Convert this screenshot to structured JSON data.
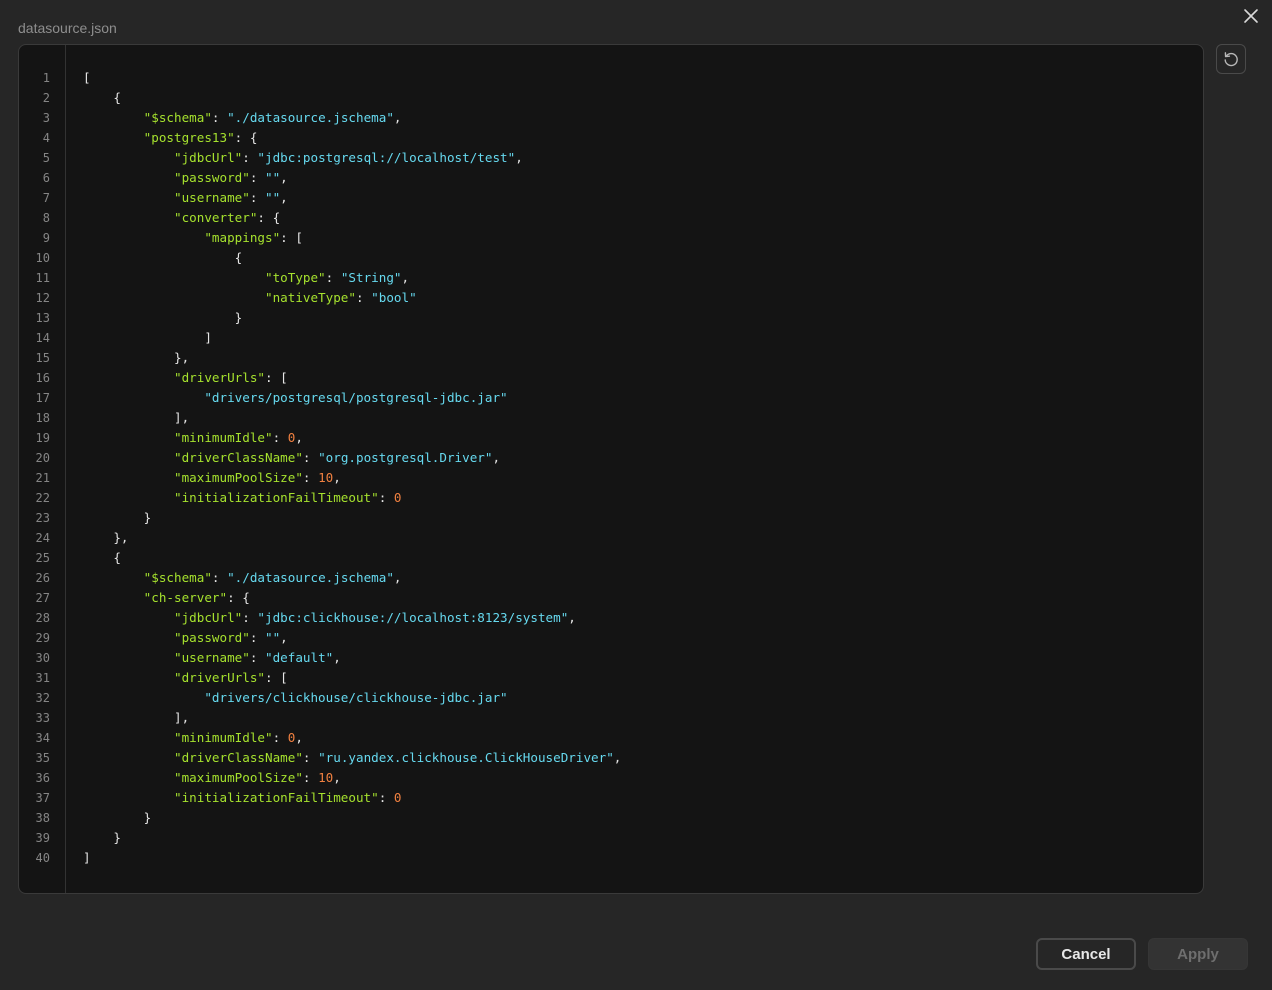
{
  "dialog": {
    "title": "datasource.json",
    "cancel_label": "Cancel",
    "apply_label": "Apply",
    "apply_disabled": true
  },
  "icons": {
    "close": "close-icon",
    "reset": "reset-icon"
  },
  "colors": {
    "background": "#262626",
    "editor_background": "#141414",
    "key": "#a6e22e",
    "string": "#66d9ef",
    "number": "#f08040",
    "punctuation": "#e6e6e6",
    "line_number": "#858585"
  },
  "editor": {
    "line_numbers": [
      "1",
      "2",
      "3",
      "4",
      "5",
      "6",
      "7",
      "8",
      "9",
      "10",
      "11",
      "12",
      "13",
      "14",
      "15",
      "16",
      "17",
      "18",
      "19",
      "20",
      "21",
      "22",
      "23",
      "24",
      "25",
      "26",
      "27",
      "28",
      "29",
      "30",
      "31",
      "32",
      "33",
      "34",
      "35",
      "36",
      "37",
      "38",
      "39",
      "40"
    ],
    "lines": [
      [
        {
          "t": "p",
          "v": "["
        }
      ],
      [
        {
          "t": "p",
          "v": "    {"
        }
      ],
      [
        {
          "t": "p",
          "v": "        "
        },
        {
          "t": "k",
          "v": "\"$schema\""
        },
        {
          "t": "p",
          "v": ": "
        },
        {
          "t": "s",
          "v": "\"./datasource.jschema\""
        },
        {
          "t": "p",
          "v": ","
        }
      ],
      [
        {
          "t": "p",
          "v": "        "
        },
        {
          "t": "k",
          "v": "\"postgres13\""
        },
        {
          "t": "p",
          "v": ": {"
        }
      ],
      [
        {
          "t": "p",
          "v": "            "
        },
        {
          "t": "k",
          "v": "\"jdbcUrl\""
        },
        {
          "t": "p",
          "v": ": "
        },
        {
          "t": "s",
          "v": "\"jdbc:postgresql://localhost/test\""
        },
        {
          "t": "p",
          "v": ","
        }
      ],
      [
        {
          "t": "p",
          "v": "            "
        },
        {
          "t": "k",
          "v": "\"password\""
        },
        {
          "t": "p",
          "v": ": "
        },
        {
          "t": "s",
          "v": "\"\""
        },
        {
          "t": "p",
          "v": ","
        }
      ],
      [
        {
          "t": "p",
          "v": "            "
        },
        {
          "t": "k",
          "v": "\"username\""
        },
        {
          "t": "p",
          "v": ": "
        },
        {
          "t": "s",
          "v": "\"\""
        },
        {
          "t": "p",
          "v": ","
        }
      ],
      [
        {
          "t": "p",
          "v": "            "
        },
        {
          "t": "k",
          "v": "\"converter\""
        },
        {
          "t": "p",
          "v": ": {"
        }
      ],
      [
        {
          "t": "p",
          "v": "                "
        },
        {
          "t": "k",
          "v": "\"mappings\""
        },
        {
          "t": "p",
          "v": ": ["
        }
      ],
      [
        {
          "t": "p",
          "v": "                    {"
        }
      ],
      [
        {
          "t": "p",
          "v": "                        "
        },
        {
          "t": "k",
          "v": "\"toType\""
        },
        {
          "t": "p",
          "v": ": "
        },
        {
          "t": "s",
          "v": "\"String\""
        },
        {
          "t": "p",
          "v": ","
        }
      ],
      [
        {
          "t": "p",
          "v": "                        "
        },
        {
          "t": "k",
          "v": "\"nativeType\""
        },
        {
          "t": "p",
          "v": ": "
        },
        {
          "t": "s",
          "v": "\"bool\""
        }
      ],
      [
        {
          "t": "p",
          "v": "                    }"
        }
      ],
      [
        {
          "t": "p",
          "v": "                ]"
        }
      ],
      [
        {
          "t": "p",
          "v": "            },"
        }
      ],
      [
        {
          "t": "p",
          "v": "            "
        },
        {
          "t": "k",
          "v": "\"driverUrls\""
        },
        {
          "t": "p",
          "v": ": ["
        }
      ],
      [
        {
          "t": "p",
          "v": "                "
        },
        {
          "t": "s",
          "v": "\"drivers/postgresql/postgresql-jdbc.jar\""
        }
      ],
      [
        {
          "t": "p",
          "v": "            ],"
        }
      ],
      [
        {
          "t": "p",
          "v": "            "
        },
        {
          "t": "k",
          "v": "\"minimumIdle\""
        },
        {
          "t": "p",
          "v": ": "
        },
        {
          "t": "n",
          "v": "0"
        },
        {
          "t": "p",
          "v": ","
        }
      ],
      [
        {
          "t": "p",
          "v": "            "
        },
        {
          "t": "k",
          "v": "\"driverClassName\""
        },
        {
          "t": "p",
          "v": ": "
        },
        {
          "t": "s",
          "v": "\"org.postgresql.Driver\""
        },
        {
          "t": "p",
          "v": ","
        }
      ],
      [
        {
          "t": "p",
          "v": "            "
        },
        {
          "t": "k",
          "v": "\"maximumPoolSize\""
        },
        {
          "t": "p",
          "v": ": "
        },
        {
          "t": "n",
          "v": "10"
        },
        {
          "t": "p",
          "v": ","
        }
      ],
      [
        {
          "t": "p",
          "v": "            "
        },
        {
          "t": "k",
          "v": "\"initializationFailTimeout\""
        },
        {
          "t": "p",
          "v": ": "
        },
        {
          "t": "n",
          "v": "0"
        }
      ],
      [
        {
          "t": "p",
          "v": "        }"
        }
      ],
      [
        {
          "t": "p",
          "v": "    },"
        }
      ],
      [
        {
          "t": "p",
          "v": "    {"
        }
      ],
      [
        {
          "t": "p",
          "v": "        "
        },
        {
          "t": "k",
          "v": "\"$schema\""
        },
        {
          "t": "p",
          "v": ": "
        },
        {
          "t": "s",
          "v": "\"./datasource.jschema\""
        },
        {
          "t": "p",
          "v": ","
        }
      ],
      [
        {
          "t": "p",
          "v": "        "
        },
        {
          "t": "k",
          "v": "\"ch-server\""
        },
        {
          "t": "p",
          "v": ": {"
        }
      ],
      [
        {
          "t": "p",
          "v": "            "
        },
        {
          "t": "k",
          "v": "\"jdbcUrl\""
        },
        {
          "t": "p",
          "v": ": "
        },
        {
          "t": "s",
          "v": "\"jdbc:clickhouse://localhost:8123/system\""
        },
        {
          "t": "p",
          "v": ","
        }
      ],
      [
        {
          "t": "p",
          "v": "            "
        },
        {
          "t": "k",
          "v": "\"password\""
        },
        {
          "t": "p",
          "v": ": "
        },
        {
          "t": "s",
          "v": "\"\""
        },
        {
          "t": "p",
          "v": ","
        }
      ],
      [
        {
          "t": "p",
          "v": "            "
        },
        {
          "t": "k",
          "v": "\"username\""
        },
        {
          "t": "p",
          "v": ": "
        },
        {
          "t": "s",
          "v": "\"default\""
        },
        {
          "t": "p",
          "v": ","
        }
      ],
      [
        {
          "t": "p",
          "v": "            "
        },
        {
          "t": "k",
          "v": "\"driverUrls\""
        },
        {
          "t": "p",
          "v": ": ["
        }
      ],
      [
        {
          "t": "p",
          "v": "                "
        },
        {
          "t": "s",
          "v": "\"drivers/clickhouse/clickhouse-jdbc.jar\""
        }
      ],
      [
        {
          "t": "p",
          "v": "            ],"
        }
      ],
      [
        {
          "t": "p",
          "v": "            "
        },
        {
          "t": "k",
          "v": "\"minimumIdle\""
        },
        {
          "t": "p",
          "v": ": "
        },
        {
          "t": "n",
          "v": "0"
        },
        {
          "t": "p",
          "v": ","
        }
      ],
      [
        {
          "t": "p",
          "v": "            "
        },
        {
          "t": "k",
          "v": "\"driverClassName\""
        },
        {
          "t": "p",
          "v": ": "
        },
        {
          "t": "s",
          "v": "\"ru.yandex.clickhouse.ClickHouseDriver\""
        },
        {
          "t": "p",
          "v": ","
        }
      ],
      [
        {
          "t": "p",
          "v": "            "
        },
        {
          "t": "k",
          "v": "\"maximumPoolSize\""
        },
        {
          "t": "p",
          "v": ": "
        },
        {
          "t": "n",
          "v": "10"
        },
        {
          "t": "p",
          "v": ","
        }
      ],
      [
        {
          "t": "p",
          "v": "            "
        },
        {
          "t": "k",
          "v": "\"initializationFailTimeout\""
        },
        {
          "t": "p",
          "v": ": "
        },
        {
          "t": "n",
          "v": "0"
        }
      ],
      [
        {
          "t": "p",
          "v": "        }"
        }
      ],
      [
        {
          "t": "p",
          "v": "    }"
        }
      ],
      [
        {
          "t": "p",
          "v": "]"
        }
      ]
    ]
  }
}
